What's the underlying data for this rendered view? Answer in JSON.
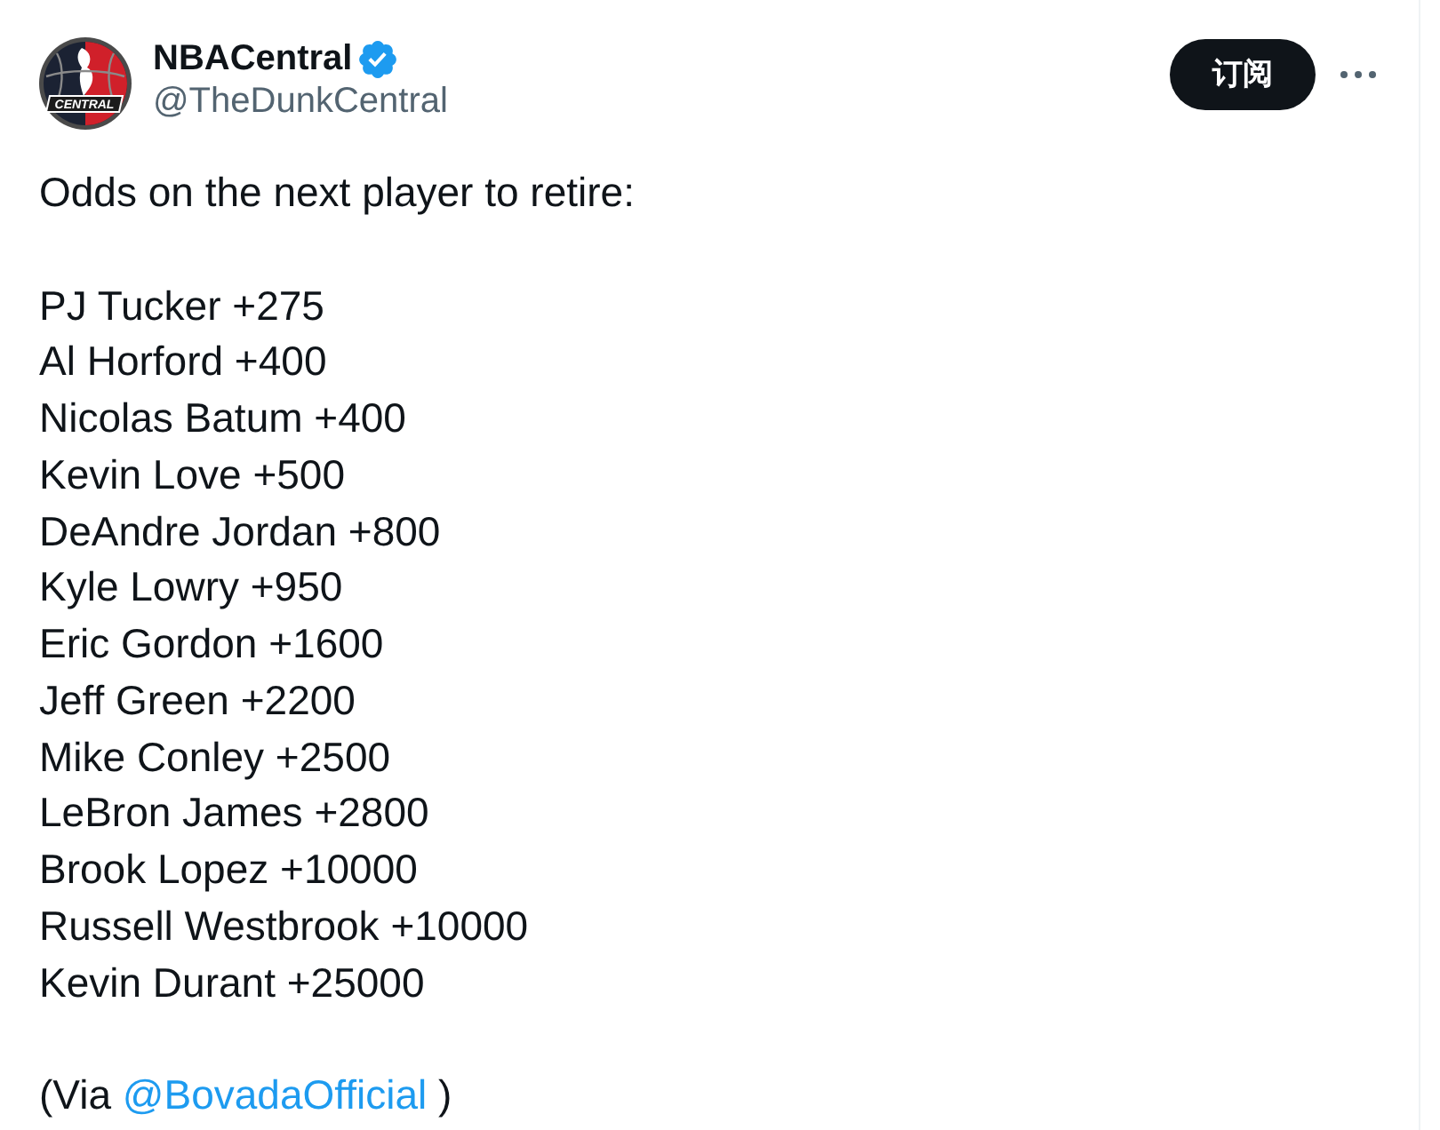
{
  "author": {
    "name": "NBACentral",
    "verified": true,
    "handle": "@TheDunkCentral",
    "logo_text": "CENTRAL"
  },
  "actions": {
    "subscribe": "订阅"
  },
  "tweet": {
    "intro": "Odds on the next player to retire:",
    "odds": [
      "PJ Tucker +275",
      "Al Horford +400",
      "Nicolas Batum +400",
      "Kevin Love +500",
      "DeAndre Jordan +800",
      "Kyle Lowry +950",
      "Eric Gordon +1600",
      "Jeff Green +2200",
      "Mike Conley +2500",
      "LeBron James +2800",
      "Brook Lopez +10000",
      "Russell Westbrook +10000",
      "Kevin Durant +25000"
    ],
    "source": {
      "prefix": "(Via",
      "mention": "@BovadaOfficial",
      "suffix": ")"
    }
  }
}
